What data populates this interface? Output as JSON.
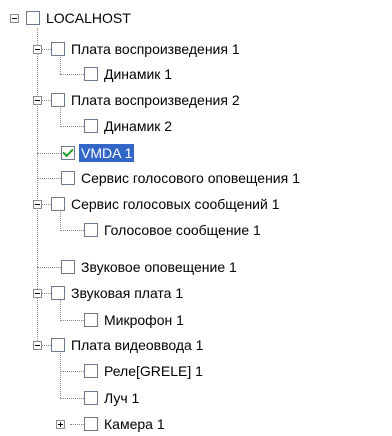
{
  "header_clipped_text": "…",
  "tree": {
    "root": {
      "label": "LOCALHOST",
      "expanded": true,
      "checked": false
    },
    "items": [
      {
        "label": "Плата воспроизведения 1",
        "checked": false,
        "expanded": true
      },
      {
        "label": "Динамик 1",
        "checked": false
      },
      {
        "label": "Плата воспроизведения 2",
        "checked": false,
        "expanded": true
      },
      {
        "label": "Динамик 2",
        "checked": false
      },
      {
        "label": "VMDA 1",
        "checked": true,
        "selected": true
      },
      {
        "label": "Сервис голосового оповещения 1",
        "checked": false
      },
      {
        "label": "Сервис голосовых сообщений 1",
        "checked": false,
        "expanded": true
      },
      {
        "label": "Голосовое сообщение 1",
        "checked": false
      },
      {
        "label": "Звуковое оповещение 1",
        "checked": false
      },
      {
        "label": "Звуковая плата 1",
        "checked": false,
        "expanded": true
      },
      {
        "label": "Микрофон 1",
        "checked": false
      },
      {
        "label": "Плата видеоввода 1",
        "checked": false,
        "expanded": true
      },
      {
        "label": "Реле[GRELE] 1",
        "checked": false
      },
      {
        "label": "Луч 1",
        "checked": false
      },
      {
        "label": "Камера 1",
        "checked": false,
        "expanded": false
      }
    ]
  },
  "colors": {
    "selection": "#3267c8",
    "check": "#1f9b24",
    "border": "#6d7a8e"
  }
}
